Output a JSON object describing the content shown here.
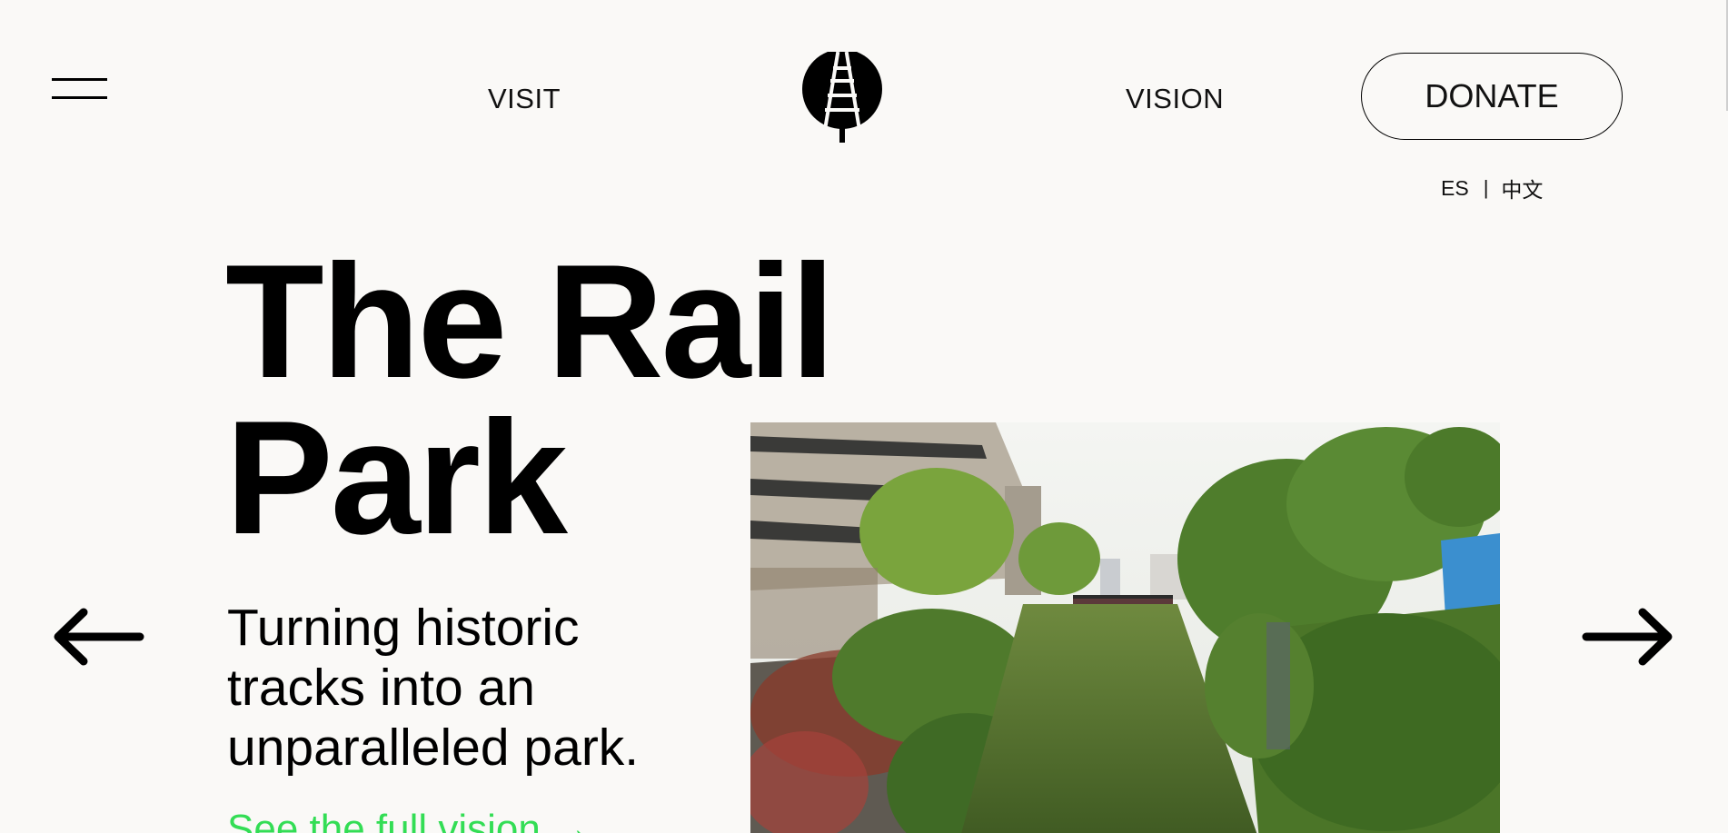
{
  "header": {
    "menu_icon": "hamburger-menu-icon",
    "nav_left": "VISIT",
    "logo_icon": "rail-tree-logo-icon",
    "nav_right": "VISION",
    "donate": "DONATE",
    "lang_es": "ES",
    "lang_sep": "|",
    "lang_zh": "中文"
  },
  "hero": {
    "title_line1": "The Rail",
    "title_line2": "Park",
    "subtitle": "Turning historic tracks into an unparalleled park.",
    "link": "See the full vision →",
    "image_desc_icon": "overgrown-rail-cut-photo"
  },
  "carousel": {
    "prev_icon": "arrow-left-icon",
    "next_icon": "arrow-right-icon"
  },
  "colors": {
    "background": "#faf9f7",
    "text": "#000000",
    "link_green": "#33dd55"
  }
}
